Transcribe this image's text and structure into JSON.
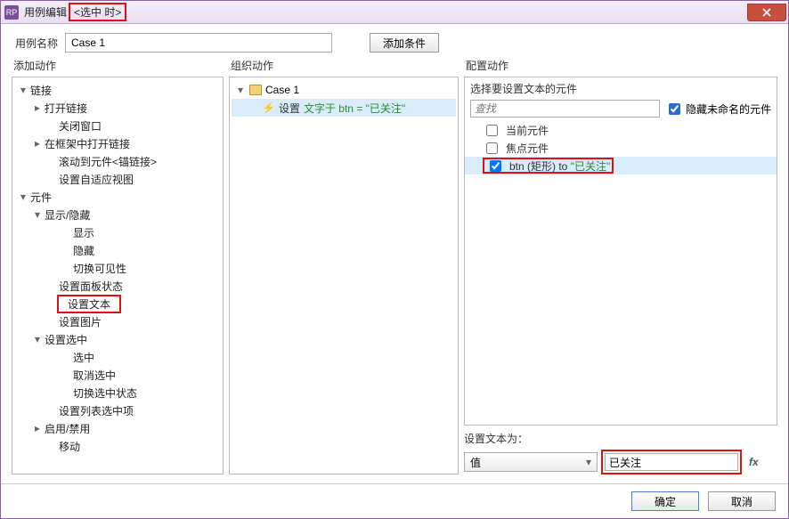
{
  "window": {
    "app_badge": "RP",
    "title_prefix": "用例编辑",
    "title_highlight": "<选中 时>"
  },
  "toprow": {
    "name_label": "用例名称",
    "case_name": "Case 1",
    "add_condition": "添加条件"
  },
  "columns": {
    "add_action": "添加动作",
    "organize_action": "组织动作",
    "configure_action": "配置动作"
  },
  "tree": {
    "links": "链接",
    "open_link": "打开链接",
    "close_window": "关闭窗口",
    "open_in_frame": "在框架中打开链接",
    "scroll_to": "滚动到元件<锚链接>",
    "set_adaptive": "设置自适应视图",
    "widgets": "元件",
    "show_hide": "显示/隐藏",
    "show": "显示",
    "hide": "隐藏",
    "toggle_vis": "切换可见性",
    "panel_state": "设置面板状态",
    "set_text": "设置文本",
    "set_image": "设置图片",
    "set_selected": "设置选中",
    "selected": "选中",
    "unselect": "取消选中",
    "toggle_sel": "切换选中状态",
    "set_list_item": "设置列表选中项",
    "enable_disable": "启用/禁用",
    "move": "移动"
  },
  "org": {
    "case_label": "Case 1",
    "action_word": "设置",
    "action_text_pre": "文字于 btn = ",
    "action_text_val": "\"已关注\""
  },
  "cfg": {
    "select_widget_title": "选择要设置文本的元件",
    "search_placeholder": "查找",
    "hide_unnamed": "隐藏未命名的元件",
    "current_widget": "当前元件",
    "focus_widget": "焦点元件",
    "btn_row_pre": "btn (矩形) to ",
    "btn_row_val": "\"已关注\"",
    "set_text_to": "设置文本为：",
    "value_combo": "值",
    "value_input": "已关注",
    "fx": "fx"
  },
  "footer": {
    "ok": "确定",
    "cancel": "取消"
  }
}
